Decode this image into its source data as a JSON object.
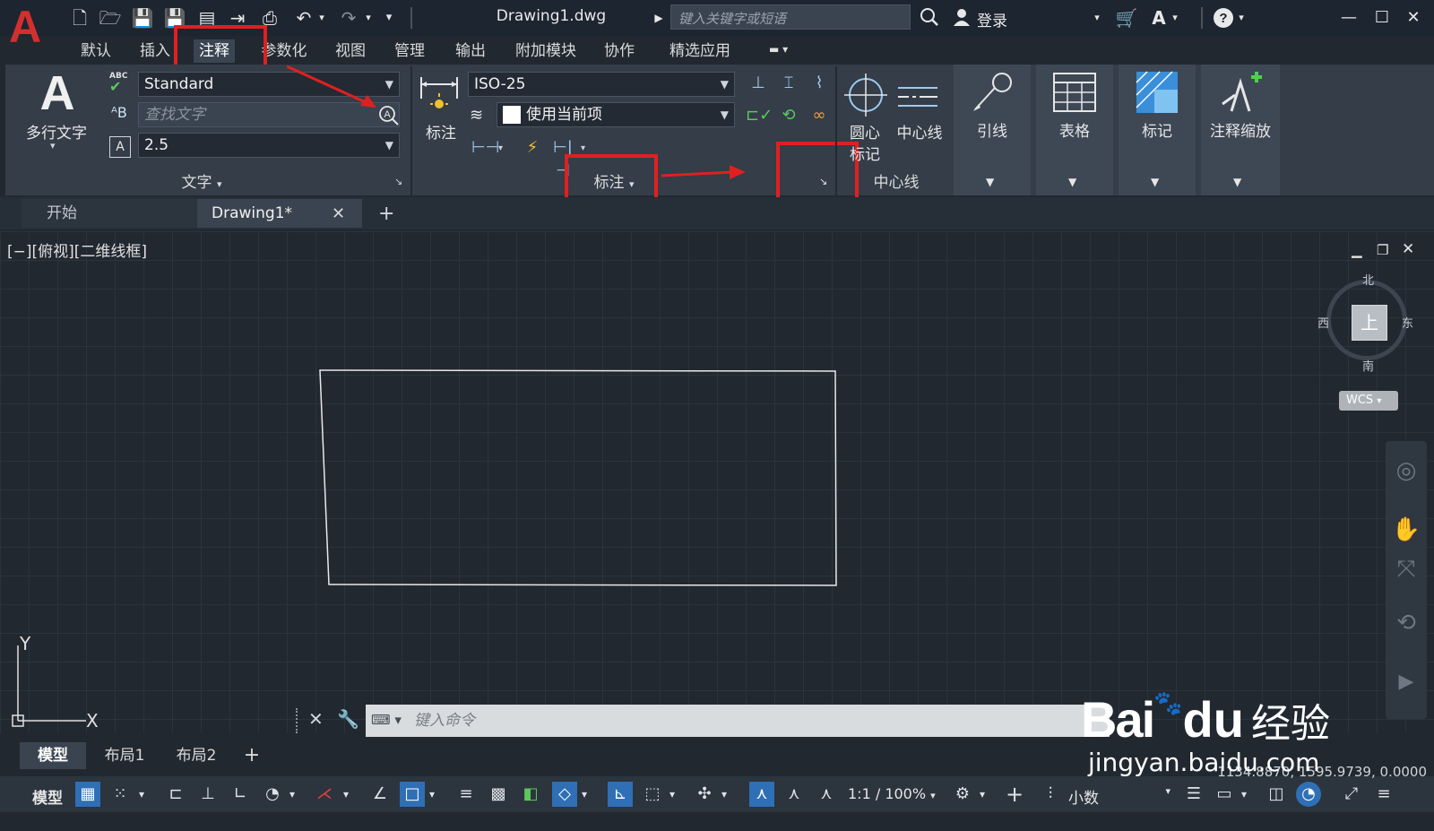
{
  "app": {
    "logo": "A",
    "document_title": "Drawing1.dwg",
    "search_placeholder": "键入关键字或短语",
    "login_label": "登录"
  },
  "menu_tabs": [
    "默认",
    "插入",
    "注释",
    "参数化",
    "视图",
    "管理",
    "输出",
    "附加模块",
    "协作",
    "精选应用"
  ],
  "active_menu_tab": "注释",
  "ribbon": {
    "text_panel": {
      "mtext_label": "多行文字",
      "text_style": "Standard",
      "find_text_placeholder": "查找文字",
      "text_height": "2.5",
      "panel_title": "文字",
      "abc_label": "ABC"
    },
    "dimension_panel": {
      "dim_label": "标注",
      "dim_style": "ISO-25",
      "layer_option": "使用当前项",
      "panel_title": "标注"
    },
    "centerline_panel": {
      "center_mark_label_1": "圆心",
      "center_mark_label_2": "标记",
      "centerline_label": "中心线",
      "panel_title": "中心线"
    },
    "leader_label": "引线",
    "table_label": "表格",
    "markup_label": "标记",
    "annoscale_label": "注释缩放"
  },
  "doc_tabs": {
    "start_label": "开始",
    "drawing_label": "Drawing1*"
  },
  "viewport": {
    "label": "[−][俯视][二维线框]",
    "viewcube": {
      "north": "北",
      "south": "南",
      "east": "东",
      "west": "西",
      "top": "上",
      "wcs": "WCS"
    },
    "ucs_y": "Y",
    "ucs_x": "X"
  },
  "command_line": {
    "placeholder": "键入命令"
  },
  "layout_tabs": [
    "模型",
    "布局1",
    "布局2"
  ],
  "status_bar": {
    "coordinates": "1134.8870, 1595.9739, 0.0000",
    "model_label": "模型",
    "scale": "1:1 / 100%",
    "units": "小数"
  },
  "watermark": {
    "brand": "Bai",
    "brand_du": "du",
    "jingyan": "经验",
    "url": "jingyan.baidu.com"
  },
  "colors": {
    "accent_red": "#e02020",
    "autocad_red": "#d32f2f",
    "status_active": "#2f6fb5"
  }
}
